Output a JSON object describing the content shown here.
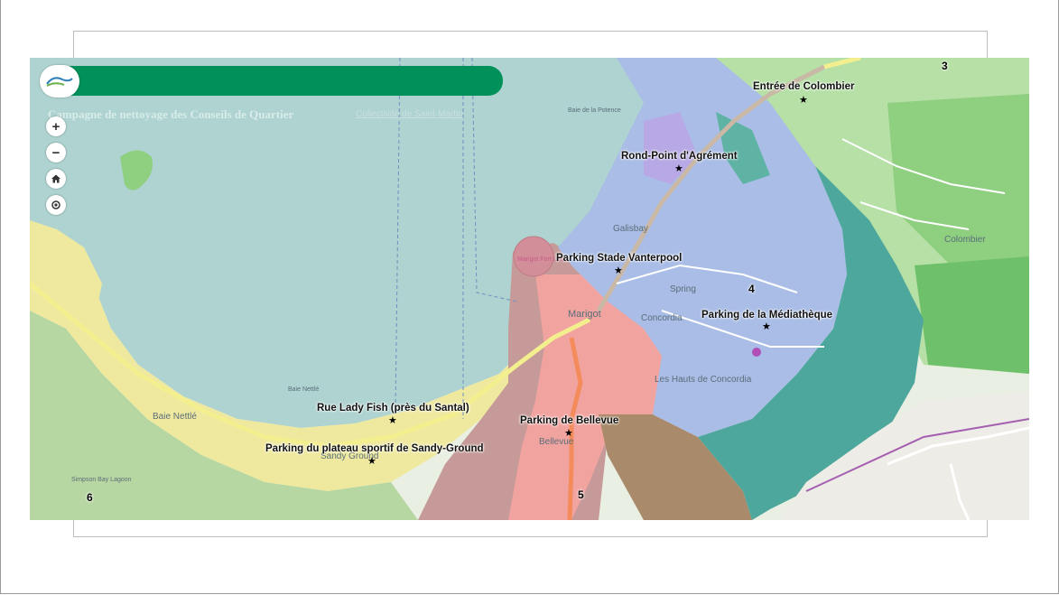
{
  "header": {
    "title": "Campagne de nettoyage des Conseils de Quartier",
    "subtitle": "Collectivité de Saint-Martin",
    "logo_icon": "collectivite-logo-icon",
    "bar_color": "#00905a"
  },
  "controls": {
    "zoom_in": "+",
    "zoom_out": "−",
    "home_icon": "home-icon",
    "locate_icon": "locate-icon"
  },
  "markers": [
    {
      "label": "Entrée de Colombier"
    },
    {
      "label": "Rond-Point d'Agrément"
    },
    {
      "label": "Parking Stade Vanterpool"
    },
    {
      "label": "Parking de la Médiathèque"
    },
    {
      "label": "Rue Lady Fish (près du Santal)"
    },
    {
      "label": "Parking de Bellevue"
    },
    {
      "label": "Parking du plateau sportif de Sandy-Ground"
    }
  ],
  "zone_numbers": [
    "3",
    "4",
    "5",
    "6"
  ],
  "places": [
    "Galisbay",
    "Spring",
    "Concordia",
    "Marigot",
    "Les Hauts de Concordia",
    "Bellevue",
    "Baie Nettlé",
    "Sandy Ground",
    "Colombier",
    "Baie de la Potence",
    "Baie Nettlé",
    "Simpson Bay Lagoon",
    "Marigot Fort Louis"
  ],
  "zone_colors": {
    "zone3": "#9fd49a",
    "zone4": "#a9bde6",
    "zone5": "#f1a3a0",
    "zone6": "#c9dc7a",
    "teal": "#4ea79c",
    "water": "#aed3d0"
  }
}
